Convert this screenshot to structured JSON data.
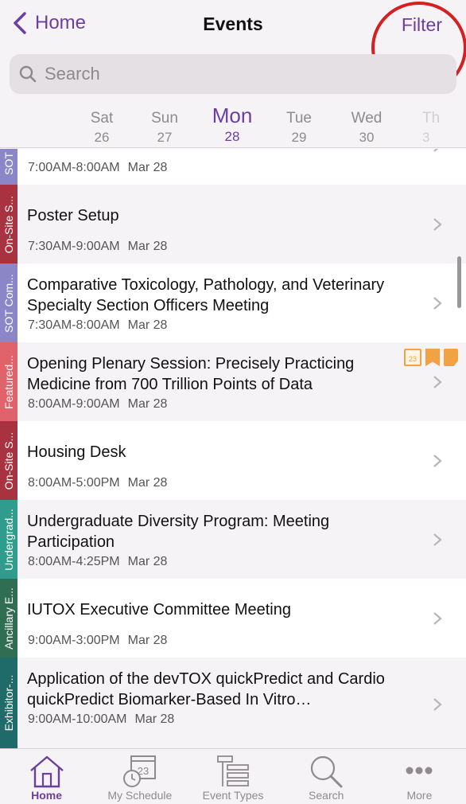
{
  "nav": {
    "back_label": "Home",
    "title": "Events",
    "filter_label": "Filter"
  },
  "search": {
    "placeholder": "Search"
  },
  "days": [
    {
      "name": "Sat",
      "date": "26"
    },
    {
      "name": "Sun",
      "date": "27"
    },
    {
      "name": "Mon",
      "date": "28",
      "selected": true
    },
    {
      "name": "Tue",
      "date": "29"
    },
    {
      "name": "Wed",
      "date": "30"
    },
    {
      "name": "Th",
      "date": "3"
    }
  ],
  "events": [
    {
      "tag": "SOT Com...",
      "tag_color": "#8a86c8",
      "title": "",
      "time": "7:00AM-8:00AM",
      "date": "Mar 28"
    },
    {
      "tag": "On-Site S...",
      "tag_color": "#a8323f",
      "title": "Poster Setup",
      "time": "7:30AM-9:00AM",
      "date": "Mar 28"
    },
    {
      "tag": "SOT Com...",
      "tag_color": "#8a86c8",
      "title": "Comparative Toxicology, Pathology, and Veterinary Specialty Section Officers Meeting",
      "time": "7:30AM-8:00AM",
      "date": "Mar 28"
    },
    {
      "tag": "Featured...",
      "tag_color": "#e0626a",
      "title": "Opening Plenary Session: Precisely Practicing Medicine from 700 Trillion Points of Data",
      "time": "8:00AM-9:00AM",
      "date": "Mar 28",
      "badge_cal_text": "23"
    },
    {
      "tag": "On-Site S...",
      "tag_color": "#a8323f",
      "title": "Housing Desk",
      "time": "8:00AM-5:00PM",
      "date": "Mar 28"
    },
    {
      "tag": "Undergrad...",
      "tag_color": "#2f9c8d",
      "title": "Undergraduate Diversity Program: Meeting Participation",
      "time": "8:00AM-4:25PM",
      "date": "Mar 28"
    },
    {
      "tag": "Ancillary E...",
      "tag_color": "#2f6e52",
      "title": "IUTOX Executive Committee Meeting",
      "time": "9:00AM-3:00PM",
      "date": "Mar 28"
    },
    {
      "tag": "Exhibitor-...",
      "tag_color": "#1f6b6a",
      "title": "Application of the devTOX quickPredict and Cardio quickPredict Biomarker-Based In Vitro…",
      "time": "9:00AM-10:00AM",
      "date": "Mar 28"
    }
  ],
  "tabbar": {
    "home": "Home",
    "my_schedule": "My Schedule",
    "my_schedule_icon_text": "23",
    "event_types": "Event Types",
    "search": "Search",
    "more": "More"
  },
  "colors": {
    "accent": "#6b3fa0",
    "annotation": "#d42020",
    "badge": "#f2a341"
  }
}
